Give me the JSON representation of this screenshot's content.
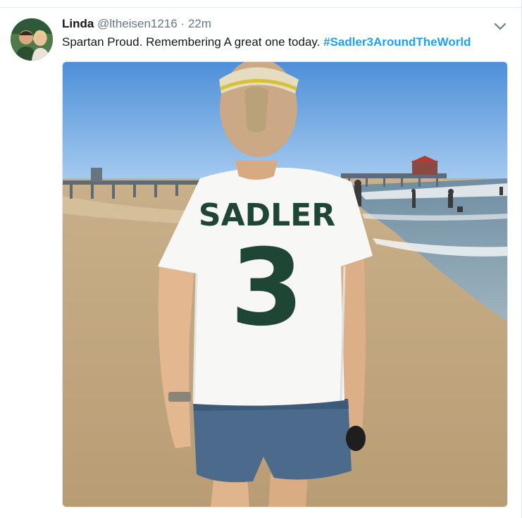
{
  "tweet": {
    "author_name": "Linda",
    "handle": "@ltheisen1216",
    "separator": "·",
    "time": "22m",
    "text": "Spartan Proud. Remembering A great one today.",
    "hashtag": "#Sadler3AroundTheWorld",
    "avatar_icon": "profile-photo-icon",
    "menu_icon": "chevron-down-icon",
    "media": {
      "description_icon": "beach-photo-icon",
      "jersey_name": "SADLER",
      "jersey_number": "3"
    }
  },
  "colors": {
    "link": "#1da1f2",
    "secondary_text": "#657786",
    "primary_text": "#14171a",
    "border": "#e6ecf0"
  }
}
